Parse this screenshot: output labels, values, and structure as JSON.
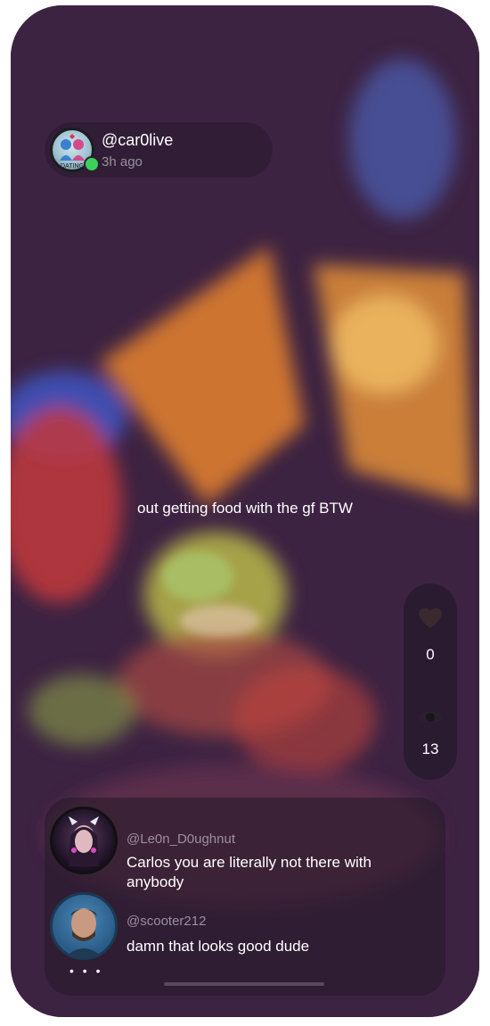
{
  "post": {
    "username": "@car0live",
    "time": "3h ago",
    "caption": "out getting food with the gf BTW",
    "avatar_badge": "DATING"
  },
  "stats": {
    "likes": "0",
    "views": "13",
    "like_icon": "heart-icon",
    "view_icon": "eye-icon"
  },
  "comments": [
    {
      "username": "@Le0n_D0ughnut",
      "text": "Carlos you are literally not there with anybody"
    },
    {
      "username": "@scooter212",
      "text": "damn that looks good dude"
    }
  ],
  "more_label": "• • •",
  "colors": {
    "online": "#3bd25b",
    "muted_text": "#9b8fa0",
    "overlay": "#26182c"
  }
}
